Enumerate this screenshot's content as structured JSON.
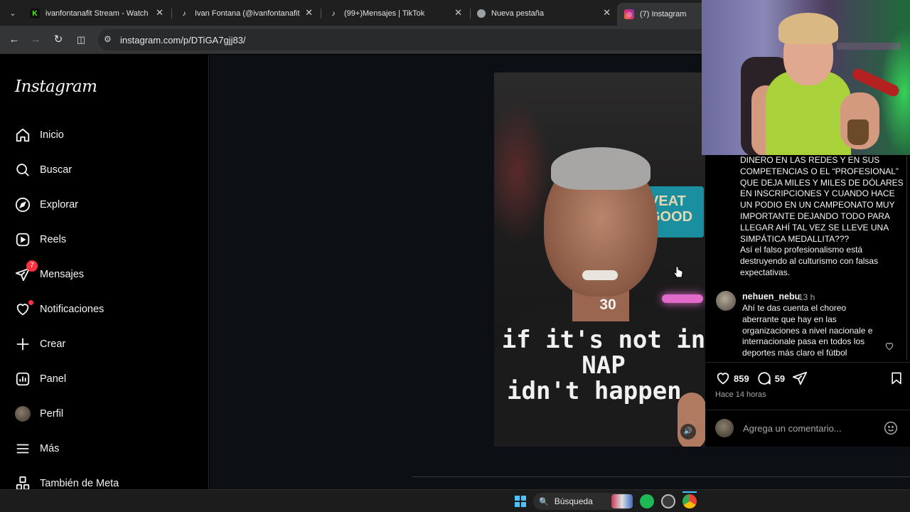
{
  "browser": {
    "tabs": [
      {
        "title": "ivanfontanafit Stream - Watch Live",
        "favicon": "kick-icon",
        "color": "#53fc18"
      },
      {
        "title": "Ivan Fontana (@ivanfontanafit) es",
        "favicon": "tiktok-icon",
        "color": "#ffffff"
      },
      {
        "title": "(99+)Mensajes | TikTok",
        "favicon": "tiktok-icon",
        "color": "#ffffff"
      },
      {
        "title": "Nueva pestaña",
        "favicon": "chrome-icon",
        "color": "#cccccc"
      },
      {
        "title": "(7) Instagram",
        "favicon": "instagram-icon",
        "color": "#e1306c"
      }
    ],
    "url": "instagram.com/p/DTiGA7gjj83/"
  },
  "sidebar": {
    "logo": "Instagram",
    "items": [
      {
        "label": "Inicio",
        "icon": "home-icon"
      },
      {
        "label": "Buscar",
        "icon": "search-icon"
      },
      {
        "label": "Explorar",
        "icon": "compass-icon"
      },
      {
        "label": "Reels",
        "icon": "reels-icon"
      },
      {
        "label": "Mensajes",
        "icon": "messenger-icon",
        "badge": "7"
      },
      {
        "label": "Notificaciones",
        "icon": "heart-icon"
      },
      {
        "label": "Crear",
        "icon": "plus-icon"
      },
      {
        "label": "Panel",
        "icon": "dashboard-icon"
      },
      {
        "label": "Perfil",
        "icon": "avatar"
      },
      {
        "label": "Más",
        "icon": "menu-icon"
      },
      {
        "label": "También de Meta",
        "icon": "meta-icon"
      }
    ]
  },
  "post": {
    "video": {
      "overlay_number": "30",
      "slogan_lines": [
        "if it's not in",
        "NAP",
        "idn't happen"
      ],
      "sign_text": "VEAT\nGOOD"
    },
    "caption": "DINERO EN LAS REDES Y EN SUS COMPETENCIAS O EL “PROFESIONAL” QUE DEJA MILES Y MILES DE DÓLARES EN INSCRIPCIONES Y CUANDO HACE UN PODIO EN UN CAMPEONATO MUY IMPORTANTE DEJANDO TODO PARA LLEGAR AHÍ TAL VEZ SE LLEVE UNA SIMPÁTICA MEDALLITA???\nAsí el falso profesionalismo está destruyendo al culturismo con falsas expectativas.",
    "comment": {
      "user": "nehuen_nebu",
      "time": "13 h",
      "text": "Ahí te das cuenta el choreo aberrante que hay en las organizaciones a nivel nacionale e internacionale pasa en todos los deportes más claro el fútbol"
    },
    "likes": "859",
    "comments_count": "59",
    "posted": "Hace 14 horas",
    "add_comment_placeholder": "Agrega un comentario..."
  },
  "taskbar": {
    "search_label": "Búsqueda"
  }
}
